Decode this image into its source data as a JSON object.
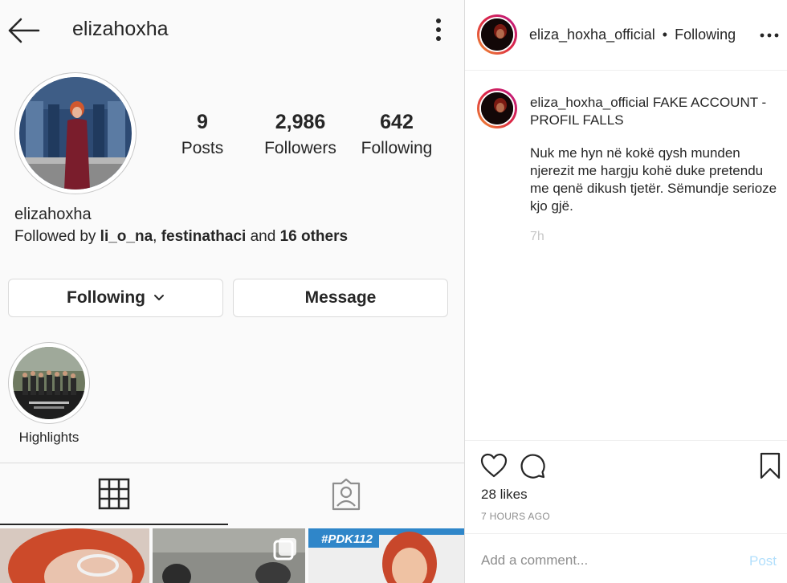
{
  "profile": {
    "username": "elizahoxha",
    "display_name": "elizahoxha",
    "stats": {
      "posts": {
        "count": "9",
        "label": "Posts"
      },
      "followers": {
        "count": "2,986",
        "label": "Followers"
      },
      "following": {
        "count": "642",
        "label": "Following"
      }
    },
    "followed_by": {
      "prefix": "Followed by",
      "user1": "li_o_na",
      "separator": ",",
      "user2": "festinathaci",
      "and": "and",
      "others": "16 others"
    },
    "buttons": {
      "following_label": "Following",
      "message_label": "Message"
    },
    "highlight": {
      "label": "Highlights"
    },
    "tabs": [
      {
        "icon": "grid-icon"
      },
      {
        "icon": "tagged-icon"
      }
    ],
    "thumb3_hashtag": "#PDK112"
  },
  "post": {
    "header": {
      "username": "eliza_hoxha_official",
      "dot": "•",
      "follow_status": "Following"
    },
    "caption": {
      "username": "eliza_hoxha_official",
      "title": "FAKE ACCOUNT - PROFIL FALLS",
      "body": "Nuk me hyn në kokë qysh munden njerezit me hargju kohë duke pretendu me qenë dikush tjetër. Sëmundje serioze kjo gjë.",
      "time": "7h"
    },
    "likes": "28 likes",
    "posted_time": "7 HOURS AGO",
    "comment_placeholder": "Add a comment...",
    "post_button": "Post"
  },
  "colors": {
    "text": "#262626",
    "secondary": "#8e8e8e",
    "border": "#dbdbdb",
    "post_disabled": "#b2dffc"
  }
}
